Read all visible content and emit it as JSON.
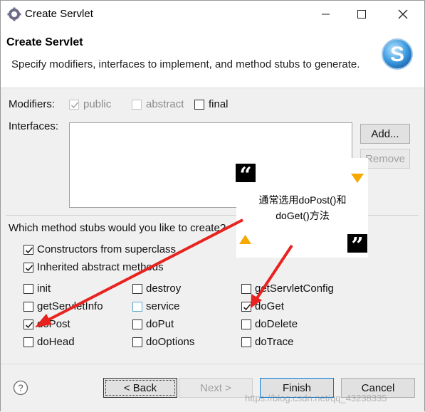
{
  "window": {
    "title": "Create Servlet"
  },
  "banner": {
    "title": "Create Servlet",
    "description": "Specify modifiers, interfaces to implement, and method stubs to generate."
  },
  "modifiers": {
    "label": "Modifiers:",
    "public": {
      "label": "public",
      "checked": true,
      "enabled": false
    },
    "abstract": {
      "label": "abstract",
      "checked": false,
      "enabled": false
    },
    "final": {
      "label": "final",
      "checked": false,
      "enabled": true
    }
  },
  "interfaces": {
    "label": "Interfaces:",
    "items": [],
    "add_label": "Add...",
    "remove_label": "Remove"
  },
  "stubs": {
    "question": "Which method stubs would you like to create?",
    "constructors": {
      "label": "Constructors from superclass",
      "checked": true
    },
    "inherited": {
      "label": "Inherited abstract methods",
      "checked": true
    },
    "methods": [
      {
        "label": "init",
        "checked": false
      },
      {
        "label": "destroy",
        "checked": false
      },
      {
        "label": "getServletConfig",
        "checked": false
      },
      {
        "label": "getServletInfo",
        "checked": false
      },
      {
        "label": "service",
        "checked": false
      },
      {
        "label": "doGet",
        "checked": true
      },
      {
        "label": "doPost",
        "checked": true
      },
      {
        "label": "doPut",
        "checked": false
      },
      {
        "label": "doDelete",
        "checked": false
      },
      {
        "label": "doHead",
        "checked": false
      },
      {
        "label": "doOptions",
        "checked": false
      },
      {
        "label": "doTrace",
        "checked": false
      }
    ]
  },
  "footer": {
    "back_label": "< Back",
    "next_label": "Next >",
    "finish_label": "Finish",
    "cancel_label": "Cancel"
  },
  "annotation": {
    "line1": "通常选用doPost()和",
    "line2": "doGet()方法",
    "arrow_color": "#e8231f",
    "accent_color": "#f5a800"
  },
  "watermark": "https://blog.csdn.net/qq_43238335"
}
